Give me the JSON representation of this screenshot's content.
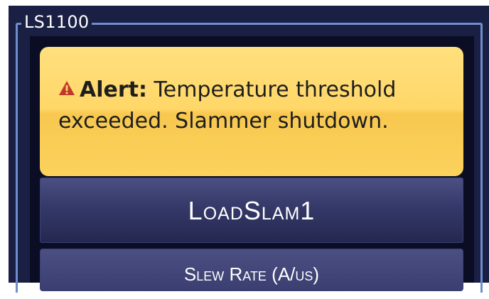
{
  "panel": {
    "title": "LS1100"
  },
  "alert": {
    "icon": "warning-triangle-icon",
    "label": "Alert:",
    "message": "Temperature threshold exceeded. Slammer shutdown."
  },
  "device_button": {
    "label": "LoadSlam1"
  },
  "slew_rate": {
    "label": "Slew Rate (A/us)"
  },
  "colors": {
    "background": "#1a1f44",
    "frame_border": "#6f8fcc",
    "alert_yellow": "#ffd768",
    "alert_icon": "#c0392b",
    "button": "#353969"
  }
}
